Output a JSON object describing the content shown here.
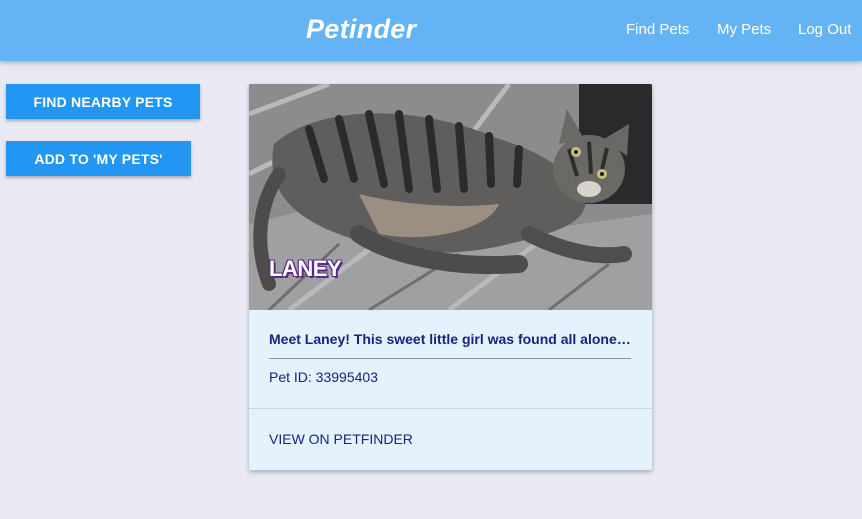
{
  "header": {
    "brand": "Petinder",
    "nav": [
      "Find Pets",
      "My Pets",
      "Log Out"
    ]
  },
  "sidebar": {
    "find_nearby_label": "FIND NEARBY PETS",
    "add_to_my_pets_label": "ADD TO 'MY PETS'"
  },
  "pet_card": {
    "name": "LANEY",
    "description": "Meet Laney! This sweet little girl was found all alone on the streets and is looking for a loving home.",
    "pet_id": "Pet ID: 33995403",
    "link_label": "VIEW ON PETFINDER"
  },
  "colors": {
    "header_bg": "#63b3f5",
    "button_bg": "#2196f3",
    "card_bg": "#e3f2fd",
    "text_dark": "#1a237e",
    "page_bg": "#e9e9f4"
  }
}
